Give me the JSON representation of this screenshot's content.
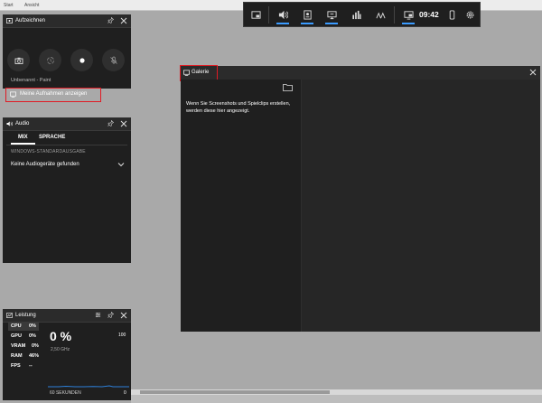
{
  "paint": {
    "menu_items": [
      "Start",
      "Ansicht"
    ]
  },
  "gamebar": {
    "time": "09:42"
  },
  "aufzeichnen": {
    "title": "Aufzeichnen",
    "status": "Unbenannt - Paint",
    "show_captures_label": "Meine Aufnahmen anzeigen"
  },
  "audio": {
    "title": "Audio",
    "tabs": [
      "MIX",
      "SPRACHE"
    ],
    "section_label": "WINDOWS-STANDARDAUSGABE",
    "device_text": "Keine Audiogeräte gefunden"
  },
  "galerie": {
    "title": "Galerie",
    "empty_message": "Wenn Sie Screenshots und Spielclips erstellen, werden diese hier angezeigt."
  },
  "leistung": {
    "title": "Leistung",
    "metrics": [
      {
        "label": "CPU",
        "value": "0%"
      },
      {
        "label": "GPU",
        "value": "0%"
      },
      {
        "label": "VRAM",
        "value": "0%"
      },
      {
        "label": "RAM",
        "value": "46%"
      },
      {
        "label": "FPS",
        "value": "--"
      }
    ],
    "big_value": "0 %",
    "sub_value": "2,50 GHz",
    "graph_max": "100",
    "graph_min": "0",
    "graph_footer": "60 SEKUNDEN"
  },
  "colors": {
    "accent": "#3b9bff",
    "highlight_border": "#e01b24",
    "panel_bg": "#1f1f1f"
  }
}
